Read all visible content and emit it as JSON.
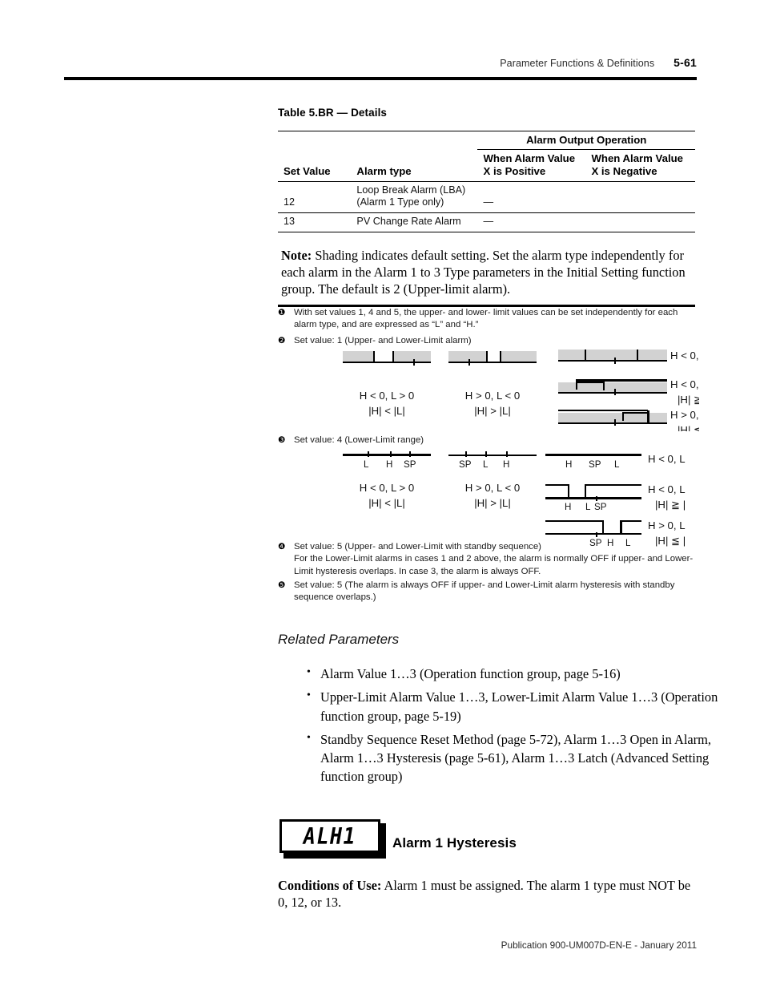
{
  "header": {
    "title": "Parameter Functions & Definitions",
    "page_number": "5-61"
  },
  "table": {
    "caption": "Table 5.BR — Details",
    "group_header": "Alarm Output Operation",
    "columns": [
      "Set Value",
      "Alarm type",
      "When Alarm Value X is Positive",
      "When Alarm Value X is Negative"
    ],
    "columns_split": {
      "pos_line1": "When Alarm Value",
      "pos_line2": "X is Positive",
      "neg_line1": "When Alarm Value",
      "neg_line2": "X is Negative"
    },
    "rows": [
      {
        "set_value": "12",
        "alarm_type_line1": "Loop Break Alarm (LBA)",
        "alarm_type_line2": "(Alarm 1 Type only)",
        "positive": "—",
        "negative": ""
      },
      {
        "set_value": "13",
        "alarm_type_line1": "PV Change Rate Alarm",
        "alarm_type_line2": "",
        "positive": "—",
        "negative": ""
      }
    ],
    "note_label": "Note:",
    "note_text": " Shading indicates default setting. Set the alarm type independently for each alarm in the Alarm 1 to 3 Type parameters in the Initial Setting function group. The default is 2 (Upper-limit alarm)."
  },
  "footnotes": {
    "one": {
      "marker": "❶",
      "text": "With set values 1, 4 and 5, the upper- and lower- limit values can be set independently for each alarm type, and are expressed as “L” and “H.”"
    },
    "two": {
      "marker": "❷",
      "text": "Set value: 1 (Upper- and Lower-Limit alarm)"
    },
    "three": {
      "marker": "❸",
      "text": "Set value: 4 (Lower-Limit range)"
    },
    "four": {
      "marker": "❹",
      "line1": "Set value: 5 (Upper- and Lower-Limit with standby sequence)",
      "line2": "For the Lower-Limit alarms in cases 1 and 2 above, the alarm is normally OFF if upper- and Lower-Limit hysteresis overlaps. In case 3, the alarm is always OFF."
    },
    "five": {
      "marker": "❺",
      "text": "Set value: 5 (The alarm is always OFF if upper- and Lower-Limit alarm hysteresis with standby sequence overlaps.)"
    }
  },
  "figures": {
    "group2": {
      "case1": {
        "line1": "H < 0, L > 0",
        "line2": "|H| < |L|"
      },
      "case2": {
        "line1": "H > 0, L < 0",
        "line2": "|H| > |L|"
      },
      "case3_top": {
        "line1": "H < 0,",
        "line2": ""
      },
      "case3_mid": {
        "line1": "H < 0,",
        "line2": "|H| ≧"
      },
      "case3_bot": {
        "line1": "H > 0,",
        "line2": "|H| ≦"
      }
    },
    "group4": {
      "case1": {
        "line1": "H < 0, L > 0",
        "line2": "|H| < |L|",
        "ticks": [
          "L",
          "H",
          "SP"
        ]
      },
      "case2": {
        "line1": "H > 0, L < 0",
        "line2": "|H| > |L|",
        "ticks": [
          "SP",
          "L",
          "H"
        ]
      },
      "case3_top": {
        "label": "H < 0, L",
        "ticks": [
          "H",
          "SP",
          "L"
        ]
      },
      "case3_mid": {
        "line1": "H < 0, L",
        "line2": "|H| ≧ |",
        "ticks": [
          "H",
          "L",
          "SP"
        ]
      },
      "case3_bot": {
        "line1": "H > 0, L",
        "line2": "|H| ≦ |",
        "ticks": [
          "SP",
          "H",
          "L"
        ]
      }
    }
  },
  "related": {
    "heading": "Related Parameters",
    "items": [
      "Alarm Value 1…3 (Operation function group, page 5-16)",
      "Upper-Limit Alarm Value 1…3, Lower-Limit Alarm Value 1…3 (Operation function group, page 5-19)",
      "Standby Sequence Reset Method (page 5-72), Alarm 1…3 Open in Alarm, Alarm 1…3 Hysteresis (page 5-61), Alarm 1…3 Latch (Advanced Setting function group)"
    ]
  },
  "parameter": {
    "display_code": "ALH1",
    "title": "Alarm 1 Hysteresis",
    "conditions_label": "Conditions of Use:",
    "conditions_text": " Alarm 1 must be assigned. The alarm 1 type must NOT be 0, 12, or 13."
  },
  "footer": {
    "publication": "Publication 900-UM007D-EN-E - January 2011"
  }
}
